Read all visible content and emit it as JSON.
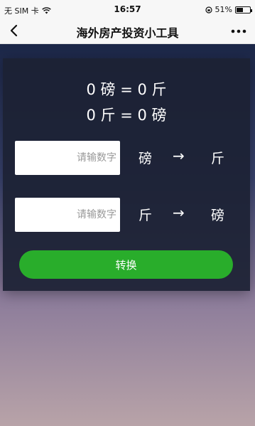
{
  "status_bar": {
    "carrier": "无 SIM 卡",
    "time": "16:57",
    "battery_text": "51%",
    "battery_level": 0.51
  },
  "nav": {
    "title": "海外房产投资小工具"
  },
  "results": {
    "line1": "0 磅 = 0 斤",
    "line2": "0 斤 = 0 磅"
  },
  "rows": [
    {
      "placeholder": "请输数字",
      "from_unit": "磅",
      "arrow": "→",
      "to_unit": "斤"
    },
    {
      "placeholder": "请输数字",
      "from_unit": "斤",
      "arrow": "→",
      "to_unit": "磅"
    }
  ],
  "convert_button": "转换"
}
